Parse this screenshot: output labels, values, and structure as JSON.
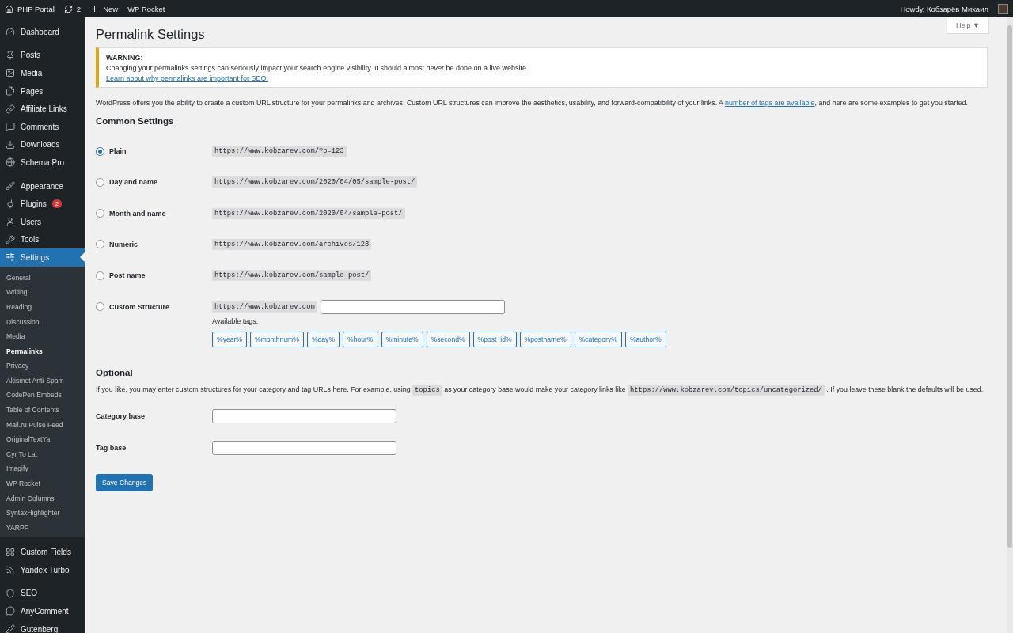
{
  "admin_bar": {
    "site": "PHP Portal",
    "updates": "2",
    "new": "New",
    "plugin": "WP Rocket",
    "greeting": "Howdy, Кобзарёв Михаил"
  },
  "sidebar": {
    "groups": [
      [
        {
          "label": "Dashboard",
          "selected": false
        }
      ],
      [
        {
          "label": "Posts",
          "selected": false
        },
        {
          "label": "Media",
          "selected": false
        },
        {
          "label": "Pages",
          "selected": false
        },
        {
          "label": "Affiliate Links",
          "selected": false
        },
        {
          "label": "Comments",
          "selected": false
        },
        {
          "label": "Downloads",
          "selected": false
        },
        {
          "label": "Schema Pro",
          "selected": false
        }
      ],
      [
        {
          "label": "Appearance",
          "selected": false
        },
        {
          "label": "Plugins",
          "selected": false,
          "badge": "2"
        },
        {
          "label": "Users",
          "selected": false
        },
        {
          "label": "Tools",
          "selected": false
        },
        {
          "label": "Settings",
          "selected": true,
          "children": [
            {
              "label": "General",
              "selected": false
            },
            {
              "label": "Writing",
              "selected": false
            },
            {
              "label": "Reading",
              "selected": false
            },
            {
              "label": "Discussion",
              "selected": false
            },
            {
              "label": "Media",
              "selected": false
            },
            {
              "label": "Permalinks",
              "selected": true
            },
            {
              "label": "Privacy",
              "selected": false
            },
            {
              "label": "Akismet Anti-Spam",
              "selected": false
            },
            {
              "label": "CodePen Embeds",
              "selected": false
            },
            {
              "label": "Table of Contents",
              "selected": false
            },
            {
              "label": "Mail.ru Pulse Feed",
              "selected": false
            },
            {
              "label": "OriginalTextYa",
              "selected": false
            },
            {
              "label": "Cyr To Lat",
              "selected": false
            },
            {
              "label": "Imagify",
              "selected": false
            },
            {
              "label": "WP Rocket",
              "selected": false
            },
            {
              "label": "Admin Columns",
              "selected": false
            },
            {
              "label": "SyntaxHighlighter",
              "selected": false
            },
            {
              "label": "YARPP",
              "selected": false
            }
          ]
        }
      ],
      [
        {
          "label": "Custom Fields",
          "selected": false
        },
        {
          "label": "Yandex Turbo",
          "selected": false
        }
      ],
      [
        {
          "label": "SEO",
          "selected": false
        },
        {
          "label": "AnyComment",
          "selected": false
        },
        {
          "label": "Gutenberg",
          "selected": false
        }
      ]
    ]
  },
  "help_tab": "Help ▼",
  "title": "Permalink Settings",
  "warning": {
    "heading": "WARNING:",
    "text": "Changing your permalinks settings can seriously impact your search engine visibility. It should almost *never* be done on a live website.",
    "link": "Learn about why permalinks are important for SEO."
  },
  "intro": [
    {
      "kind": "text",
      "text": "WordPress offers you the ability to create a custom URL structure for your permalinks and archives. Custom URL structures can improve the aesthetics, usability, and forward-compatibility of your links. A "
    },
    {
      "kind": "link",
      "text": "number of tags are available"
    },
    {
      "kind": "text",
      "text": ", and here are some examples to get you started."
    }
  ],
  "common_heading": "Common Settings",
  "options": [
    {
      "label": "Plain",
      "example": "https://www.kobzarev.com/?p=123",
      "selected": true
    },
    {
      "label": "Day and name",
      "example": "https://www.kobzarev.com/2020/04/05/sample-post/",
      "selected": false
    },
    {
      "label": "Month and name",
      "example": "https://www.kobzarev.com/2020/04/sample-post/",
      "selected": false
    },
    {
      "label": "Numeric",
      "example": "https://www.kobzarev.com/archives/123",
      "selected": false
    },
    {
      "label": "Post name",
      "example": "https://www.kobzarev.com/sample-post/",
      "selected": false
    },
    {
      "label": "Custom Structure",
      "example": "https://www.kobzarev.com",
      "selected": false,
      "kind": "custom"
    }
  ],
  "available_tags_label": "Available tags:",
  "tags": [
    "%year%",
    "%monthnum%",
    "%day%",
    "%hour%",
    "%minute%",
    "%second%",
    "%post_id%",
    "%postname%",
    "%category%",
    "%author%"
  ],
  "optional_heading": "Optional",
  "optional_text": [
    {
      "kind": "text",
      "text": "If you like, you may enter custom structures for your category and tag URLs here. For example, using "
    },
    {
      "kind": "code",
      "text": "topics"
    },
    {
      "kind": "text",
      "text": " as your category base would make your category links like "
    },
    {
      "kind": "code",
      "text": "https://www.kobzarev.com/topics/uncategorized/"
    },
    {
      "kind": "text",
      "text": " . If you leave these blank the defaults will be used."
    }
  ],
  "fields": [
    {
      "label": "Category base"
    },
    {
      "label": "Tag base"
    }
  ],
  "save_button": "Save Changes"
}
